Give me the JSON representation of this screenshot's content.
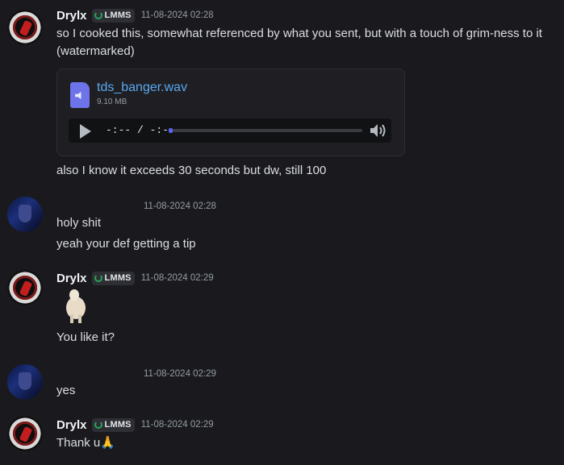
{
  "messages": [
    {
      "author": "Drylx",
      "tag": "LMMS",
      "time": "11-08-2024 02:28",
      "lines": [
        "so I cooked this, somewhat referenced by what you sent, but with a touch of grim-ness to it",
        "(watermarked)"
      ],
      "attachment": {
        "filename": "tds_banger.wav",
        "size": "9.10 MB",
        "player_time": "-:-- / -:--",
        "progress": 0.02
      },
      "after": "also I know it exceeds 30 seconds but dw, still 100"
    },
    {
      "time": "11-08-2024 02:28",
      "lines": [
        "holy shit",
        "yeah your def getting a tip"
      ]
    },
    {
      "author": "Drylx",
      "tag": "LMMS",
      "time": "11-08-2024 02:29",
      "lines": [
        "You like it?"
      ]
    },
    {
      "time": "11-08-2024 02:29",
      "lines": [
        "yes"
      ]
    },
    {
      "author": "Drylx",
      "tag": "LMMS",
      "time": "11-08-2024 02:29",
      "lines": [
        "Thank u🙏"
      ]
    }
  ]
}
